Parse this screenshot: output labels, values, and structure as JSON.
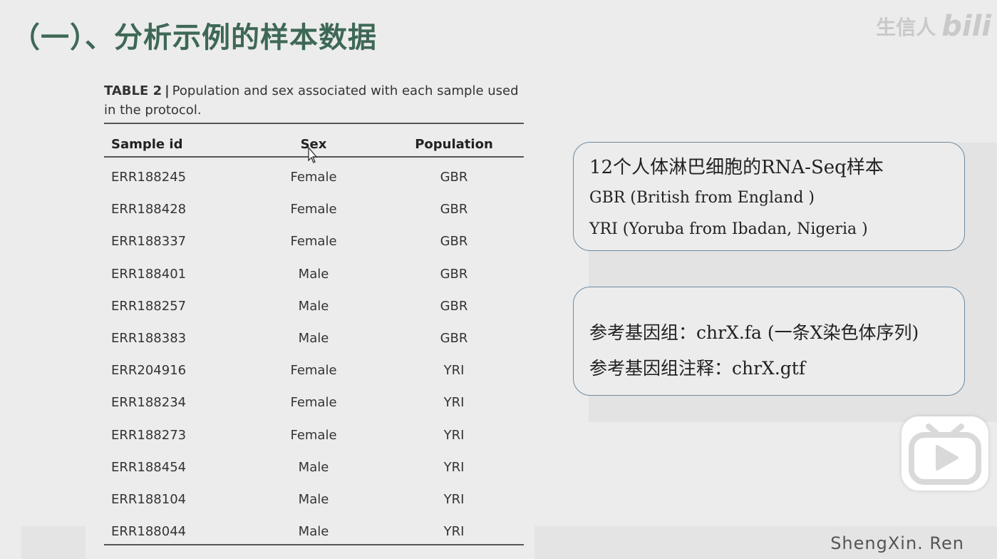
{
  "header": {
    "title": "（一）、分析示例的样本数据",
    "watermark_text": "生信人",
    "watermark_logo": "bili"
  },
  "table": {
    "caption_label": "TABLE 2",
    "caption_sep": "|",
    "caption_text": "Population and sex associated with each sample used in the protocol.",
    "columns": [
      "Sample id",
      "Sex",
      "Population"
    ],
    "rows": [
      [
        "ERR188245",
        "Female",
        "GBR"
      ],
      [
        "ERR188428",
        "Female",
        "GBR"
      ],
      [
        "ERR188337",
        "Female",
        "GBR"
      ],
      [
        "ERR188401",
        "Male",
        "GBR"
      ],
      [
        "ERR188257",
        "Male",
        "GBR"
      ],
      [
        "ERR188383",
        "Male",
        "GBR"
      ],
      [
        "ERR204916",
        "Female",
        "YRI"
      ],
      [
        "ERR188234",
        "Female",
        "YRI"
      ],
      [
        "ERR188273",
        "Female",
        "YRI"
      ],
      [
        "ERR188454",
        "Male",
        "YRI"
      ],
      [
        "ERR188104",
        "Male",
        "YRI"
      ],
      [
        "ERR188044",
        "Male",
        "YRI"
      ]
    ]
  },
  "info_box_1": {
    "line1": "12个人体淋巴细胞的RNA-Seq样本",
    "line2": "GBR (British from England )",
    "line3": "YRI (Yoruba from Ibadan, Nigeria )"
  },
  "info_box_2": {
    "line1": "参考基因组：chrX.fa (一条X染色体序列)",
    "line2": "参考基因组注释：chrX.gtf"
  },
  "footer": {
    "text": "ShengXin. Ren"
  },
  "icons": {
    "player": "bilibili-tv-play-icon",
    "cursor": "mouse-pointer-icon"
  },
  "colors": {
    "title": "#3e6856",
    "box_border": "#6d8aa0",
    "tv_icon": "#d9d9d9"
  }
}
